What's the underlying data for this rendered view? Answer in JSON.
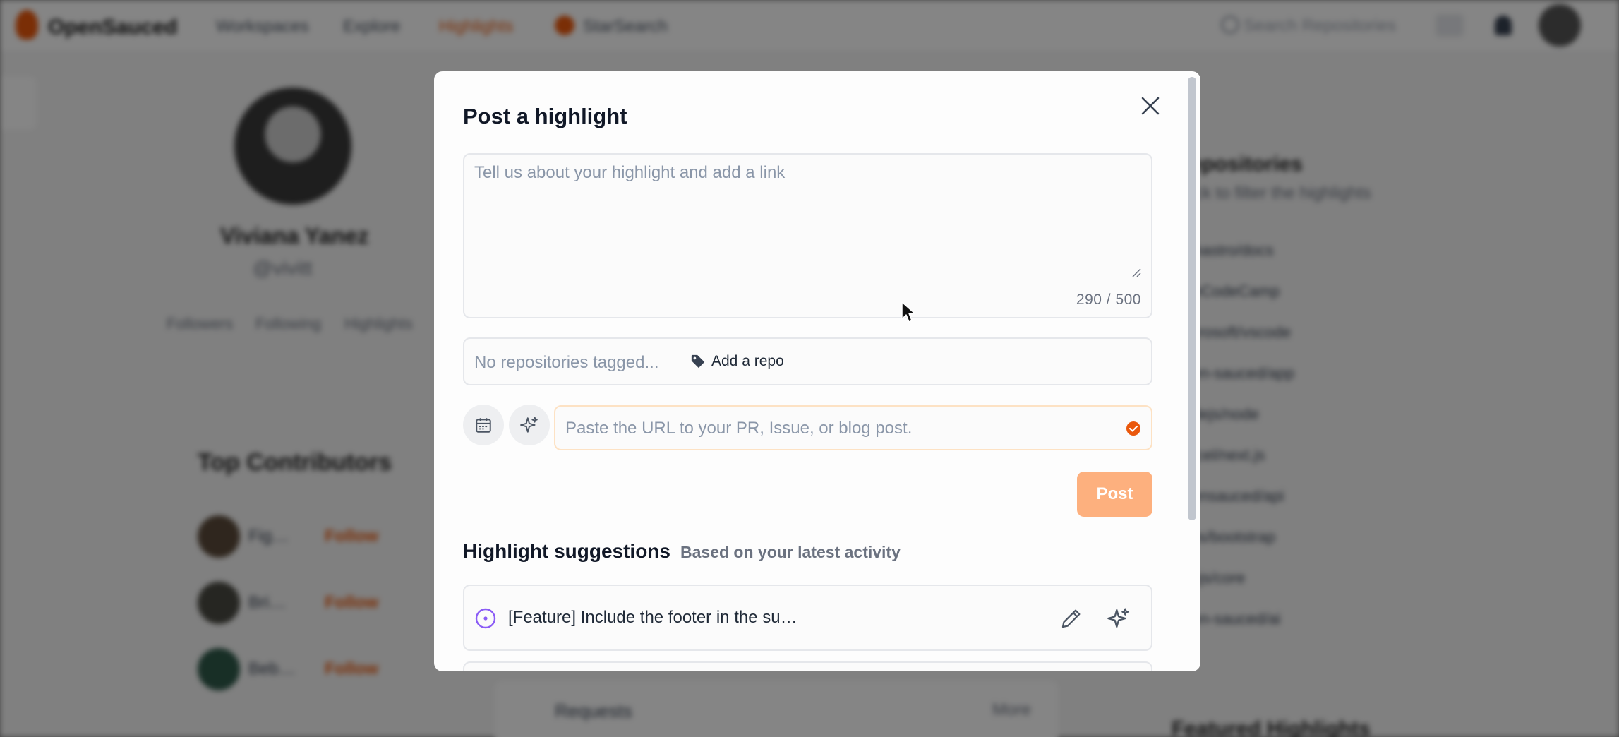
{
  "background": {
    "nav": {
      "brand": "OpenSauced",
      "links": [
        "Workspaces",
        "Explore",
        "Highlights",
        "StarSearch"
      ],
      "search_placeholder": "Search Repositories"
    },
    "profile": {
      "name": "Viviana Yanez",
      "handle": "@vivitt",
      "stats": [
        "Followers",
        "Following",
        "Highlights"
      ]
    },
    "top_contributors": {
      "title": "Top Contributors",
      "rows": [
        {
          "name": "Fig…",
          "action": "Follow"
        },
        {
          "name": "Bri…",
          "action": "Follow"
        },
        {
          "name": "Beb…",
          "action": "Follow"
        }
      ]
    },
    "repositories": {
      "title": "Repositories",
      "subtitle": "Click to filter the highlights",
      "items": [
        "withastro/docs",
        "freeCodeCamp",
        "microsoft/vscode",
        "open-sauced/app",
        "nodejs/node",
        "vercel/next.js",
        "opensauced/api",
        "twbs/bootstrap",
        "vuejs/core",
        "open-sauced/ai"
      ]
    },
    "bottom_card": {
      "label": "Requests",
      "action": "More"
    },
    "featured": "Featured Highlights"
  },
  "modal": {
    "title": "Post a highlight",
    "textarea": {
      "placeholder": "Tell us about your highlight and add a link",
      "value": "",
      "char_count": "290 / 500"
    },
    "repos": {
      "placeholder": "No repositories tagged...",
      "add_label": "Add a repo"
    },
    "url": {
      "placeholder": "Paste the URL to your PR, Issue, or blog post.",
      "value": ""
    },
    "post_label": "Post",
    "suggestions": {
      "title": "Highlight suggestions",
      "subtitle": "Based on your latest activity",
      "items": [
        {
          "text": "[Feature] Include the footer in the su…"
        },
        {
          "text": ""
        }
      ]
    }
  },
  "colors": {
    "accent": "#ea580c",
    "post_button": "#fdb07e",
    "issue_icon": "#8b5cf6",
    "overlay": "rgba(0,0,0,0.48)"
  },
  "icons": {
    "close": "close-icon",
    "tag": "tag-icon",
    "calendar": "calendar-icon",
    "sparkle": "sparkle-icon",
    "check": "check-circle-icon",
    "issue": "issue-open-icon",
    "edit": "pencil-icon"
  }
}
